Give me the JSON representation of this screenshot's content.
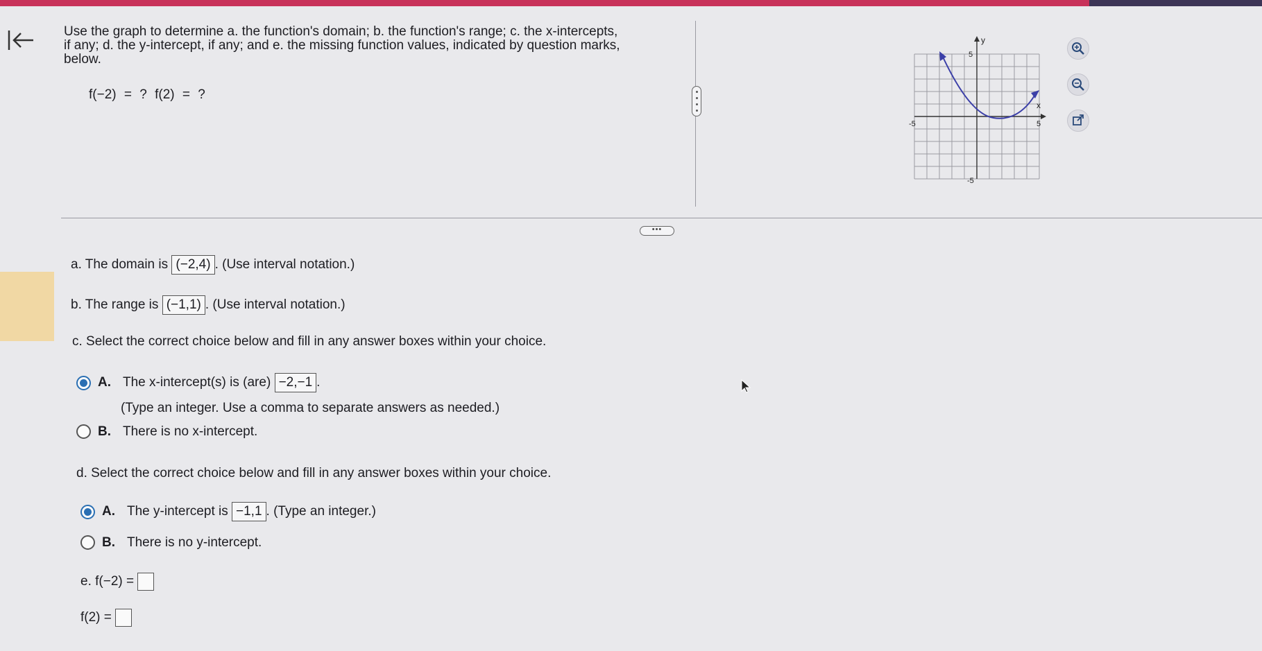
{
  "question": {
    "line1": "Use the graph to determine a. the function's domain; b. the function's range; c. the x-intercepts,",
    "line2": "if any; d. the y-intercept, if any; and e. the missing function values, indicated by question marks,",
    "line3": "below.",
    "function_values": "f(−2) = ?   f(2) = ?"
  },
  "graph": {
    "y_label": "y",
    "x_label": "x",
    "y_top_tick": "5",
    "y_bottom_tick": "-5",
    "x_left_tick": "-5",
    "x_right_tick": "5",
    "curve_color": "#3b3fa8"
  },
  "tools": {
    "zoom_in": "zoom-in-icon",
    "zoom_out": "zoom-out-icon",
    "popout": "external-link-icon"
  },
  "part_a": {
    "prefix": "a. The domain is",
    "answer": "(−2,4)",
    "suffix": ". (Use interval notation.)"
  },
  "part_b": {
    "prefix": "b. The range is",
    "answer": "(−1,1)",
    "suffix": ". (Use interval notation.)"
  },
  "part_c": {
    "instruction": "c. Select the correct choice below and fill in any answer boxes within your choice.",
    "option_a_letter": "A.",
    "option_a_text": "The x-intercept(s) is (are)",
    "option_a_answer": "−2,−1",
    "option_a_suffix": ".",
    "option_a_note": "(Type an integer. Use a comma to separate answers as needed.)",
    "option_b_letter": "B.",
    "option_b_text": "There is no x-intercept.",
    "selected": "A"
  },
  "part_d": {
    "instruction": "d. Select the correct choice below and fill in any answer boxes within your choice.",
    "option_a_letter": "A.",
    "option_a_text": "The y-intercept is",
    "option_a_answer": "−1,1",
    "option_a_suffix": ". (Type an integer.)",
    "option_b_letter": "B.",
    "option_b_text": "There is no y-intercept.",
    "selected": "A"
  },
  "part_e": {
    "line1_prefix": "e.  f(−2) =",
    "line2_prefix": "f(2) ="
  },
  "colors": {
    "accent": "#c8325a",
    "radio_selected": "#2a6fb3",
    "sidebar_tab": "#f1d8a4"
  }
}
